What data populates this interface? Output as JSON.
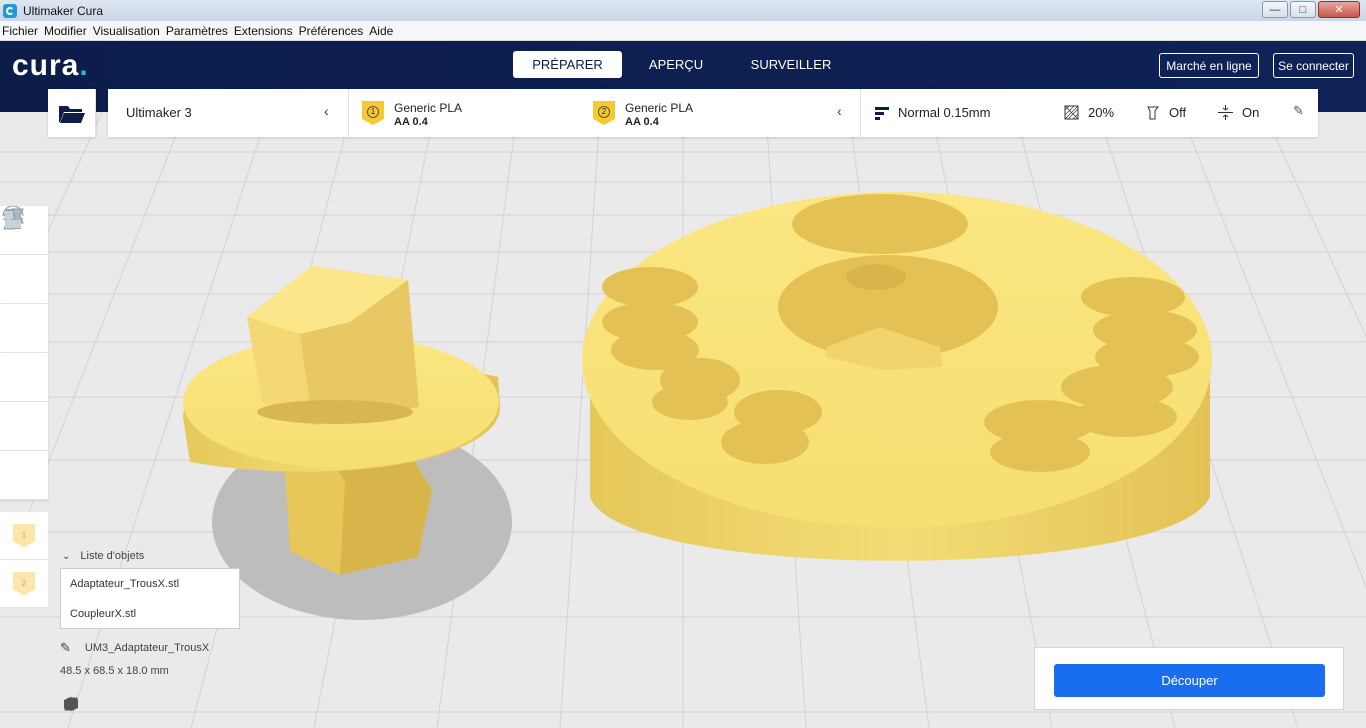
{
  "window": {
    "title": "Ultimaker Cura"
  },
  "menu": [
    "Fichier",
    "Modifier",
    "Visualisation",
    "Paramètres",
    "Extensions",
    "Préférences",
    "Aide"
  ],
  "header": {
    "logo": "cura",
    "tabs": [
      "PRÉPARER",
      "APERÇU",
      "SURVEILLER"
    ],
    "active_tab": "PRÉPARER",
    "marketplace": "Marché en ligne",
    "login": "Se connecter"
  },
  "toolbar": {
    "printer": "Ultimaker 3",
    "extruders": [
      {
        "index": "1",
        "material": "Generic PLA",
        "nozzle": "AA 0.4"
      },
      {
        "index": "2",
        "material": "Generic PLA",
        "nozzle": "AA 0.4"
      }
    ],
    "profile": "Normal 0.15mm",
    "infill": "20%",
    "support": "Off",
    "adhesion": "On"
  },
  "left_tools": [
    "move-tool",
    "scale-tool",
    "rotate-tool",
    "mirror-tool",
    "per-model-settings-tool",
    "support-blocker-tool"
  ],
  "extruder_buttons": [
    "1",
    "2"
  ],
  "object_list": {
    "title": "Liste d'objets",
    "items": [
      "Adaptateur_TrousX.stl",
      "CoupleurX.stl"
    ]
  },
  "selection": {
    "name": "UM3_Adaptateur_TrousX",
    "dimensions": "48.5 x 68.5 x 18.0 mm"
  },
  "slice_button": "Découper",
  "colors": {
    "header": "#0c1d4a",
    "accent": "#196ef0",
    "model": "#f7e07a",
    "extruder": "#f7c931"
  }
}
